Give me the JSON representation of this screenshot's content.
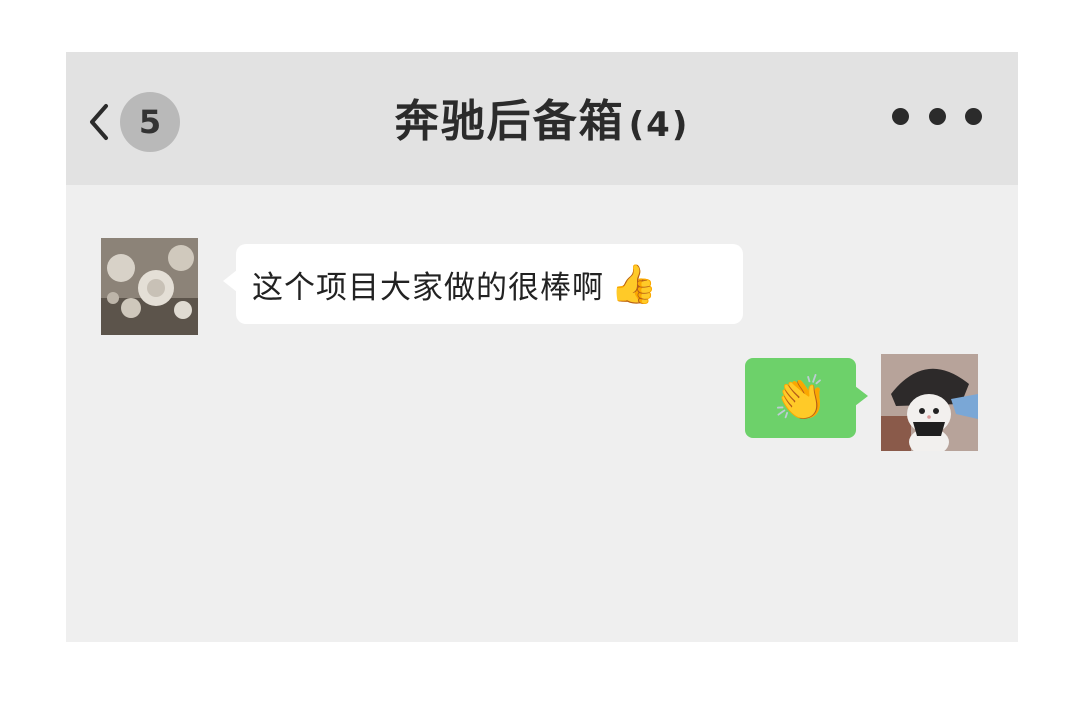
{
  "header": {
    "unread_count": "5",
    "title": "奔驰后备箱",
    "member_count": "(4)",
    "back_icon": "chevron-left-icon",
    "more_icon": "more-dots-icon"
  },
  "messages": [
    {
      "side": "left",
      "text": "这个项目大家做的很棒啊",
      "emoji": "👍",
      "avatar": "flower-avatar"
    },
    {
      "side": "right",
      "emoji": "👏",
      "avatar": "cat-avatar"
    }
  ],
  "colors": {
    "header_bg": "#e2e2e2",
    "chat_bg": "#efefef",
    "outgoing_bubble": "#6dd16a",
    "incoming_bubble": "#ffffff",
    "badge_bg": "#b9b9b9"
  }
}
